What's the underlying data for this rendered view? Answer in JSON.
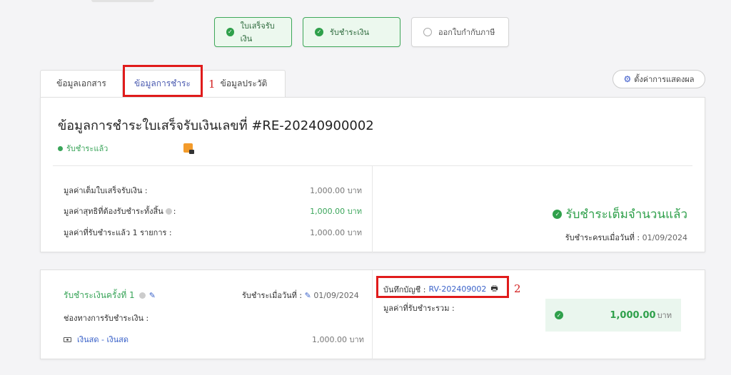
{
  "steps": [
    {
      "label": "ใบเสร็จรับเงิน",
      "status": "done"
    },
    {
      "label": "รับชำระเงิน",
      "status": "done"
    },
    {
      "label": "ออกใบกำกับภาษี",
      "status": "todo"
    }
  ],
  "tabs": [
    "ข้อมูลเอกสาร",
    "ข้อมูลการชำระ",
    "ข้อมูลประวัติ"
  ],
  "annotations": [
    "1",
    "2"
  ],
  "settings_label": "ตั้งค่าการแสดงผล",
  "summary": {
    "title": "ข้อมูลการชำระใบเสร็จรับเงินเลขที่ #RE-20240900002",
    "status": "รับชำระแล้ว",
    "rows": [
      {
        "label": "มูลค่าเต็มใบเสร็จรับเงิน :",
        "value": "1,000.00 บาท"
      },
      {
        "label": "มูลค่าสุทธิที่ต้องรับชำระทั้งสิ้น",
        "label_suffix": ":",
        "value": "1,000.00 บาท"
      },
      {
        "label": "มูลค่าที่รับชำระแล้ว 1 รายการ :",
        "value": "1,000.00 บาท"
      }
    ],
    "full_paid": "รับชำระเต็มจำนวนแล้ว",
    "full_date_label": "รับชำระครบเมื่อวันที่ :",
    "full_date": "01/09/2024"
  },
  "payment": {
    "round_label": "รับชำระเงินครั้งที่ 1",
    "date_label": "รับชำระเมื่อวันที่ :",
    "date": "01/09/2024",
    "channel_label": "ช่องทางการรับชำระเงิน :",
    "channel": "เงินสด - เงินสด",
    "channel_amount": "1,000.00 บาท",
    "account_label": "บันทึกบัญชี :",
    "account_no": "RV-202409002",
    "total_label": "มูลค่าที่รับชำระรวม :",
    "total_value": "1,000.00",
    "total_unit": "บาท"
  },
  "colors": {
    "accent": "#3a62c9",
    "success": "#2fa04b",
    "annotation": "#e01b1b"
  }
}
